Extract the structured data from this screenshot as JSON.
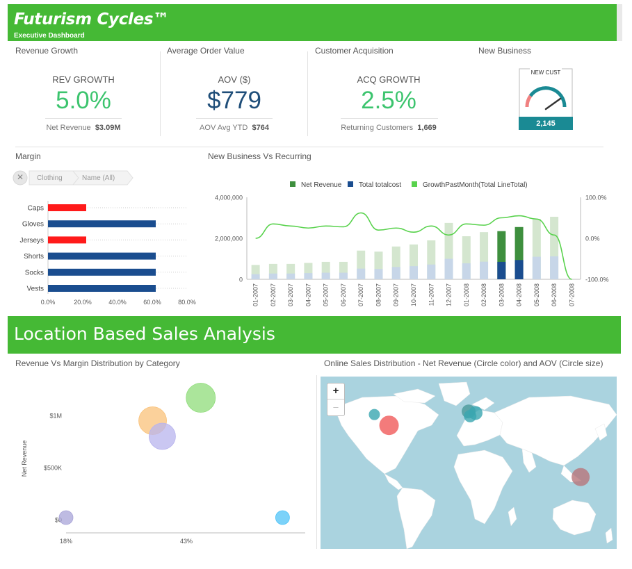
{
  "header": {
    "brand": "Futurism Cycles™",
    "subtitle": "Executive Dashboard",
    "color": "#45b935"
  },
  "kpis": {
    "revenue_growth": {
      "section": "Revenue Growth",
      "label": "REV GROWTH",
      "value": "5.0%",
      "foot_label": "Net Revenue",
      "foot_value": "$3.09M",
      "color": "#3cc46e"
    },
    "aov": {
      "section": "Average Order Value",
      "label": "AOV ($)",
      "value": "$779",
      "foot_label": "AOV Avg YTD",
      "foot_value": "$764",
      "color": "#1f4e79"
    },
    "acquisition": {
      "section": "Customer Acquisition",
      "label": "ACQ GROWTH",
      "value": "2.5%",
      "foot_label": "Returning Customers",
      "foot_value": "1,669",
      "color": "#3cc46e"
    },
    "new_business": {
      "section": "New Business",
      "gauge_label": "NEW CUST",
      "gauge_value": "2,145",
      "gauge_level": 0.8,
      "color": "#1a8a94"
    }
  },
  "margin": {
    "title": "Margin",
    "breadcrumb": [
      "Clothing",
      "Name (All)"
    ]
  },
  "nbr": {
    "title": "New Business Vs Recurring"
  },
  "location": {
    "banner": "Location Based Sales Analysis",
    "scatter_title": "Revenue Vs Margin Distribution by Category",
    "map_title": "Online Sales Distribution - Net Revenue (Circle color) and AOV (Circle size)",
    "zoom_in": "+",
    "zoom_out": "–",
    "map_bubbles": [
      {
        "lon": -122,
        "lat": 48,
        "size": 8,
        "color": "#3aa6b0"
      },
      {
        "lon": -103,
        "lat": 34,
        "size": 14,
        "color": "#f05a5a"
      },
      {
        "lon": 0,
        "lat": 52,
        "size": 10,
        "color": "#4a9a9a"
      },
      {
        "lon": 9,
        "lat": 50,
        "size": 10,
        "color": "#3aa6b0"
      },
      {
        "lon": 2,
        "lat": 46,
        "size": 9,
        "color": "#3aa6b0"
      },
      {
        "lon": 145,
        "lat": -33,
        "size": 13,
        "color": "#b8757a"
      }
    ]
  },
  "chart_data": [
    {
      "type": "bar",
      "orientation": "horizontal",
      "categories": [
        "Caps",
        "Gloves",
        "Jerseys",
        "Shorts",
        "Socks",
        "Vests"
      ],
      "values": [
        22,
        62,
        22,
        62,
        62,
        62
      ],
      "colors": [
        "#ff1a1a",
        "#1a4d8f",
        "#ff1a1a",
        "#1a4d8f",
        "#1a4d8f",
        "#1a4d8f"
      ],
      "xticks": [
        "0.0%",
        "20.0%",
        "40.0%",
        "60.0%",
        "80.0%"
      ],
      "xlim": [
        0,
        80
      ]
    },
    {
      "type": "bar",
      "title": "New Business Vs Recurring",
      "legend": [
        "Net Revenue",
        "Total totalcost",
        "GrowthPastMonth(Total LineTotal)"
      ],
      "legend_colors": [
        "#3e8f3e",
        "#1a4d8f",
        "#59d24d"
      ],
      "legend_position": "top",
      "categories": [
        "01-2007",
        "02-2007",
        "03-2007",
        "04-2007",
        "05-2007",
        "06-2007",
        "07-2007",
        "08-2007",
        "09-2007",
        "10-2007",
        "11-2007",
        "12-2007",
        "01-2008",
        "02-2008",
        "03-2008",
        "04-2008",
        "05-2008",
        "06-2008",
        "07-2008"
      ],
      "series": [
        {
          "name": "Net Revenue",
          "values": [
            700000,
            750000,
            750000,
            800000,
            850000,
            850000,
            1400000,
            1350000,
            1600000,
            1700000,
            1900000,
            2750000,
            2100000,
            2300000,
            2350000,
            2550000,
            2950000,
            3050000,
            0
          ]
        },
        {
          "name": "Total totalcost",
          "values": [
            250000,
            280000,
            280000,
            300000,
            320000,
            320000,
            520000,
            500000,
            600000,
            640000,
            720000,
            1000000,
            780000,
            860000,
            850000,
            940000,
            1100000,
            1120000,
            0
          ]
        },
        {
          "name": "GrowthPastMonth(Total LineTotal)",
          "values": [
            0,
            35,
            30,
            25,
            30,
            28,
            62,
            20,
            25,
            15,
            30,
            8,
            35,
            32,
            50,
            55,
            47,
            8,
            -100
          ]
        }
      ],
      "highlighted_categories": [
        "03-2008",
        "04-2008"
      ],
      "yticks_left": [
        "4,000,000",
        "2,000,000",
        "0"
      ],
      "ylim_left": [
        0,
        4000000
      ],
      "yticks_right": [
        "100.0%",
        "0.0%",
        "-100.0%"
      ],
      "ylim_right": [
        -100,
        100
      ]
    },
    {
      "type": "scatter",
      "title": "Revenue Vs Margin Distribution by Category",
      "ylabel": "Net Revenue",
      "xticks": [
        "18%",
        "43%"
      ],
      "yticks": [
        "$1M",
        "$500K",
        "$0"
      ],
      "points": [
        {
          "x": 18,
          "y": 20000,
          "size": 10,
          "color": "#a8a4d8"
        },
        {
          "x": 36,
          "y": 950000,
          "size": 20,
          "color": "#f9c27a"
        },
        {
          "x": 38,
          "y": 800000,
          "size": 19,
          "color": "#b8b4ee"
        },
        {
          "x": 46,
          "y": 1170000,
          "size": 21,
          "color": "#8fdc7a"
        },
        {
          "x": 63,
          "y": 20000,
          "size": 10,
          "color": "#4fc3f7"
        }
      ]
    }
  ]
}
